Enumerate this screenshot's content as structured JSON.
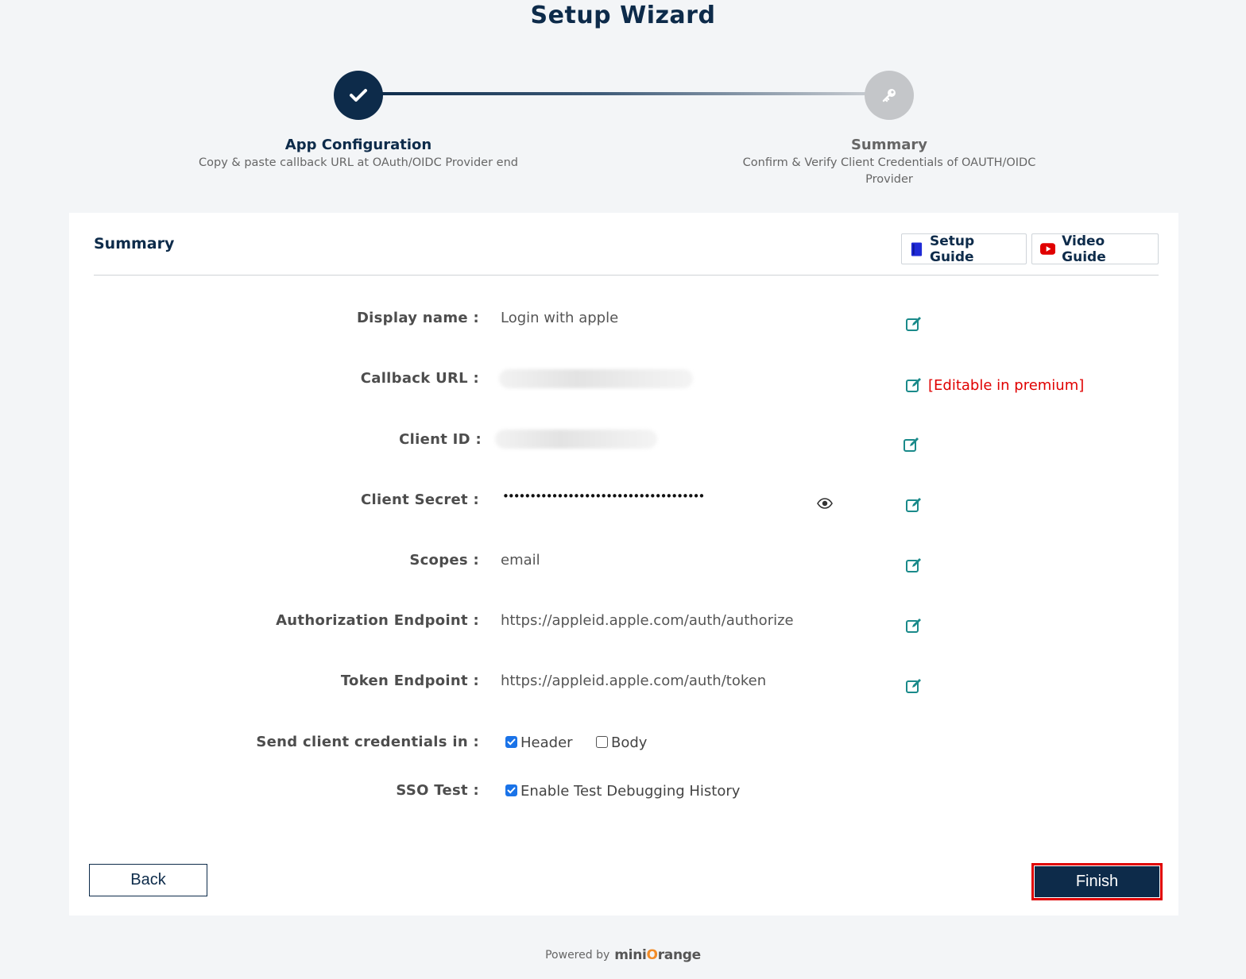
{
  "header": {
    "title": "Setup Wizard"
  },
  "steps": [
    {
      "title": "App Configuration",
      "subtitle": "Copy & paste callback URL at OAuth/OIDC Provider end",
      "status": "completed",
      "icon": "check-icon"
    },
    {
      "title": "Summary",
      "subtitle": "Confirm & Verify Client Credentials of OAUTH/OIDC Provider",
      "status": "current",
      "icon": "key-icon"
    }
  ],
  "card": {
    "title": "Summary",
    "setup_guide": "Setup Guide",
    "video_guide": "Video Guide"
  },
  "fields": {
    "display_name": {
      "label": "Display name :",
      "value": "Login with apple"
    },
    "callback_url": {
      "label": "Callback URL :",
      "premium_note": "[Editable in premium]"
    },
    "client_id": {
      "label": "Client ID :"
    },
    "client_secret": {
      "label": "Client Secret :",
      "value": "•••••••••••••••••••••••••••••••••••••"
    },
    "scopes": {
      "label": "Scopes :",
      "value": "email"
    },
    "auth_endpoint": {
      "label": "Authorization Endpoint :",
      "value": "https://appleid.apple.com/auth/authorize"
    },
    "token_endpoint": {
      "label": "Token Endpoint :",
      "value": "https://appleid.apple.com/auth/token"
    },
    "credentials_in": {
      "label": "Send client credentials in :",
      "header_label": "Header",
      "header_checked": true,
      "body_label": "Body",
      "body_checked": false
    },
    "sso_test": {
      "label": "SSO Test :",
      "option_label": "Enable Test Debugging History",
      "checked": true
    }
  },
  "actions": {
    "back": "Back",
    "finish": "Finish"
  },
  "footer": {
    "powered_by": "Powered by",
    "brand_prefix": "mini",
    "brand_o": "O",
    "brand_suffix": "range"
  },
  "colors": {
    "primary": "#0d2b4a",
    "edit_icon": "#1a8a8a",
    "premium": "#e00000",
    "checkbox": "#1a73e8",
    "highlight": "#e00000"
  }
}
